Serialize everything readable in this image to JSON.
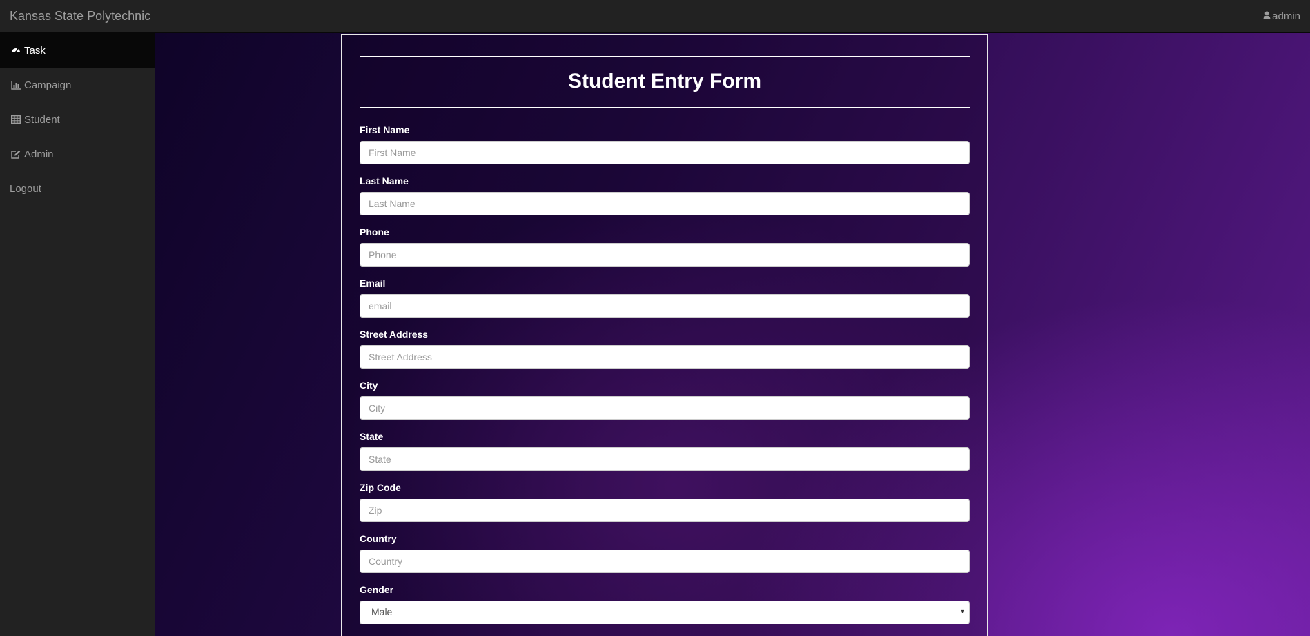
{
  "navbar": {
    "brand": "Kansas State Polytechnic",
    "user_label": "admin",
    "user_icon": "user-icon"
  },
  "sidebar": {
    "items": [
      {
        "label": "Task",
        "icon": "dashboard-icon",
        "active": true
      },
      {
        "label": "Campaign",
        "icon": "bar-chart-icon",
        "active": false
      },
      {
        "label": "Student",
        "icon": "table-icon",
        "active": false
      },
      {
        "label": "Admin",
        "icon": "edit-icon",
        "active": false
      },
      {
        "label": "Logout",
        "icon": "",
        "active": false
      }
    ]
  },
  "form": {
    "title": "Student Entry Form",
    "fields": [
      {
        "label": "First Name",
        "placeholder": "First Name",
        "value": ""
      },
      {
        "label": "Last Name",
        "placeholder": "Last Name",
        "value": ""
      },
      {
        "label": "Phone",
        "placeholder": "Phone",
        "value": ""
      },
      {
        "label": "Email",
        "placeholder": "email",
        "value": ""
      },
      {
        "label": "Street Address",
        "placeholder": "Street Address",
        "value": ""
      },
      {
        "label": "City",
        "placeholder": "City",
        "value": ""
      },
      {
        "label": "State",
        "placeholder": "State",
        "value": ""
      },
      {
        "label": "Zip Code",
        "placeholder": "Zip",
        "value": ""
      },
      {
        "label": "Country",
        "placeholder": "Country",
        "value": ""
      }
    ],
    "gender": {
      "label": "Gender",
      "selected": "Male"
    }
  },
  "colors": {
    "navbar_bg": "#222222",
    "sidebar_active_bg": "#080808",
    "accent_purple": "#5a1a8a"
  }
}
